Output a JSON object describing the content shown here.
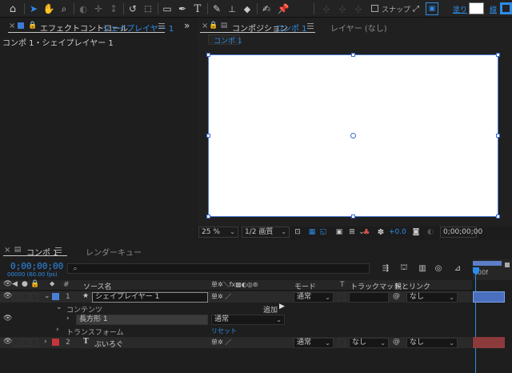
{
  "toolbar": {
    "snap_label": "スナップ",
    "fill_label": "塗り",
    "stroke_label": "線",
    "fill_color": "#ffffff",
    "stroke_color": "#2d8ceb"
  },
  "effect_panel": {
    "tab_label": "エフェクトコントロール",
    "tab_layer": "シェイプレイヤー 1",
    "breadcrumb": "コンポ 1・シェイプレイヤー 1",
    "expand_label": "»"
  },
  "comp_panel": {
    "tab_label": "コンポジション",
    "tab_comp": "コンポ 1",
    "layer_tab": "レイヤー (なし)",
    "subtab": "コンポ 1"
  },
  "viewer_bar": {
    "zoom": "25 %",
    "resolution": "1/2 画質",
    "exposure": "+0.0",
    "timecode": "0;00;00;00"
  },
  "timeline": {
    "tab_label": "コンポ 1",
    "render_queue": "レンダーキュー",
    "timecode": "0;00;00;00",
    "fps_info": "00000 (60.00 fps)",
    "search_placeholder": "",
    "ruler_start": "00f",
    "headers": {
      "number": "#",
      "source_name": "ソース名",
      "mode": "モード",
      "t": "T",
      "track_matte": "トラックマット",
      "parent_link": "親とリンク"
    },
    "layers": [
      {
        "number": "1",
        "type_icon": "★",
        "name": "シェイプレイヤー 1",
        "mode": "通常",
        "track_matte": "",
        "parent": "なし",
        "color": "#4a7fd4"
      },
      {
        "number": "2",
        "type_icon": "T",
        "name": "ぷいろぐ",
        "mode": "通常",
        "track_matte": "なし",
        "parent": "なし",
        "color": "#c8333a"
      }
    ],
    "contents_label": "コンテンツ",
    "add_label": "追加",
    "rect_label": "長方形 1",
    "rect_mode": "通常",
    "transform_label": "トランスフォーム",
    "reset_label": "リセット"
  },
  "colors": {
    "accent": "#2d8ceb",
    "layer1": "#4a7fd4",
    "layer2": "#c8333a",
    "canvas": "#ffffff"
  }
}
